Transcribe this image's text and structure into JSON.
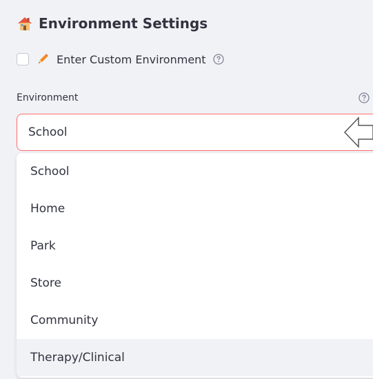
{
  "section": {
    "title": "Environment Settings",
    "title_icon": "house-icon"
  },
  "custom_toggle": {
    "label": "Enter Custom Environment",
    "checked": false,
    "icon": "pencil-icon"
  },
  "environment_field": {
    "label": "Environment",
    "selected_value": "School"
  },
  "dropdown": {
    "options": [
      "School",
      "Home",
      "Park",
      "Store",
      "Community",
      "Therapy/Clinical"
    ],
    "highlighted": "Therapy/Clinical"
  },
  "colors": {
    "focus_border": "#ff6b6b",
    "background": "#f0f2f6",
    "text": "#31333f"
  }
}
